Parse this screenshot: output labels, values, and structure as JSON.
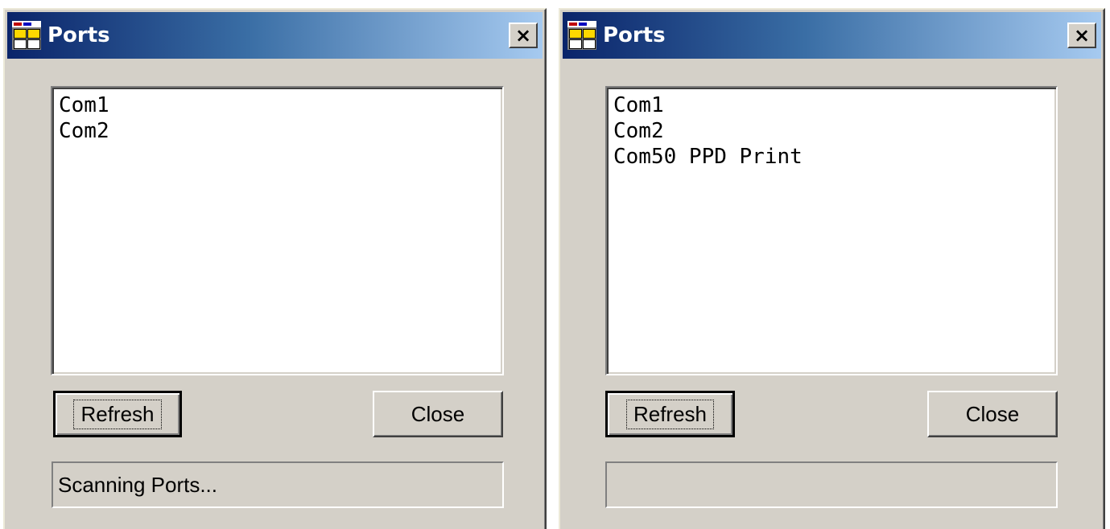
{
  "windows": [
    {
      "title": "Ports",
      "close_glyph": "×",
      "ports": [
        "Com1",
        "Com2"
      ],
      "refresh_label": "Refresh",
      "close_label": "Close",
      "status_text": "Scanning Ports..."
    },
    {
      "title": "Ports",
      "close_glyph": "×",
      "ports": [
        "Com1",
        "Com2",
        "Com50 PPD Print"
      ],
      "refresh_label": "Refresh",
      "close_label": "Close",
      "status_text": ""
    }
  ],
  "icons": {
    "app": "app-window-icon",
    "close": "close-icon"
  },
  "colors": {
    "face": "#d4d0c8",
    "title_start": "#0a246a",
    "title_end": "#a6caf0",
    "title_text": "#ffffff"
  }
}
